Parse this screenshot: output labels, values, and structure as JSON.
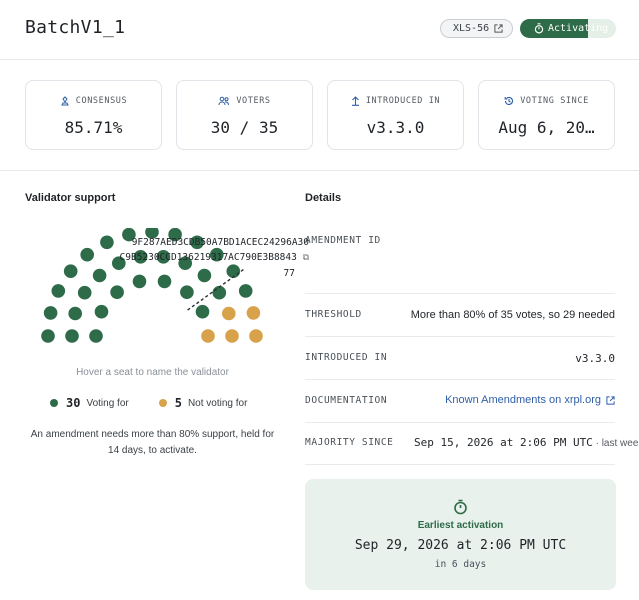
{
  "header": {
    "title": "BatchV1_1",
    "xls_label": "XLS-56",
    "status_label": "Activating",
    "status_progress": 0.71,
    "colors": {
      "accent_green": "#2e6b48",
      "accent_gold": "#d8a24a",
      "link_blue": "#2f5fa8"
    }
  },
  "stats": [
    {
      "label": "CONSENSUS",
      "value": "85.71%",
      "icon": "consensus-icon"
    },
    {
      "label": "VOTERS",
      "value": "30 / 35",
      "icon": "users-icon"
    },
    {
      "label": "INTRODUCED IN",
      "value": "v3.3.0",
      "icon": "arrow-up-icon"
    },
    {
      "label": "VOTING SINCE",
      "value": "Aug 6, 20…",
      "icon": "history-icon"
    }
  ],
  "validator_support": {
    "heading": "Validator support",
    "hover_hint": "Hover a seat to name the validator",
    "voting_for_count": "30",
    "voting_for_label": "Voting for",
    "not_voting_count": "5",
    "not_voting_label": "Not voting for",
    "seats_for": 30,
    "seats_against": 5,
    "note": "An amendment needs more than 80% support, held for 14 days, to activate."
  },
  "details": {
    "heading": "Details",
    "amendment_id_label": "AMENDMENT ID",
    "amendment_id_line1": "9F287AED3CDB50A7BD1ACEC24296A30",
    "amendment_id_line2": "C9B5230CCD136219317AC790E3B8843",
    "amendment_id_line3": "77",
    "threshold_label": "THRESHOLD",
    "threshold_value": "More than 80% of 35 votes, so 29 needed",
    "introduced_label": "INTRODUCED IN",
    "introduced_value": "v3.3.0",
    "documentation_label": "DOCUMENTATION",
    "documentation_link": "Known Amendments on xrpl.org",
    "majority_label": "MAJORITY SINCE",
    "majority_value": "Sep 15, 2026 at 2:06 PM UTC",
    "majority_sub": " · last week"
  },
  "activation": {
    "label": "Earliest activation",
    "date": "Sep 29, 2026 at 2:06 PM UTC",
    "sub": "in 6 days"
  }
}
